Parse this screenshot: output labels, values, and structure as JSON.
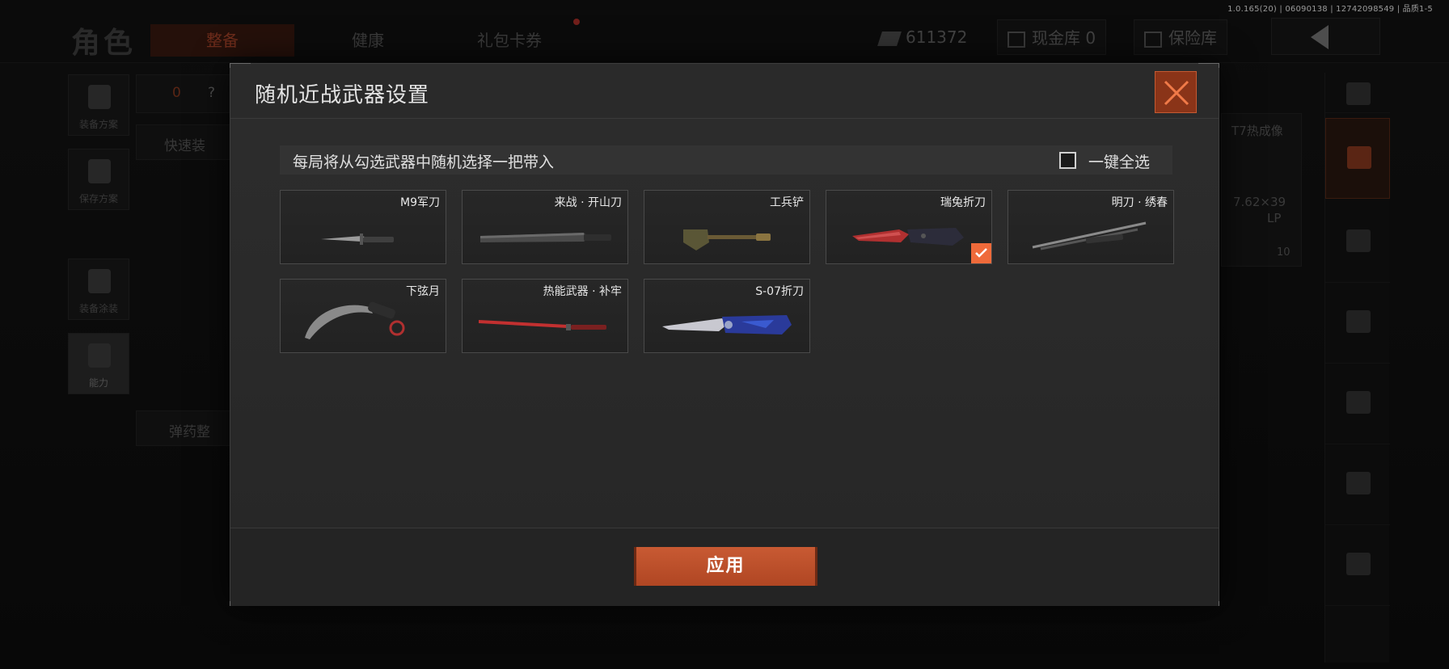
{
  "version_info": "1.0.165(20) | 06090138 | 12742098549 | 品质1-5",
  "background": {
    "page_title": "角色",
    "tabs": [
      {
        "label": "整备",
        "active": true
      },
      {
        "label": "健康",
        "active": false
      },
      {
        "label": "礼包卡券",
        "active": false
      }
    ],
    "currency_amount": "611372",
    "cash_vault": "现金库 0",
    "insurance_vault": "保险库",
    "side_menu": [
      "装备方案",
      "保存方案",
      "装备涂装",
      "能力"
    ],
    "left_panel": {
      "count": "0",
      "help": "?",
      "quick_equip": "快速装",
      "ammo": "弹药整"
    },
    "right_panel": {
      "item_name": "T7热成像",
      "ammo_name": "7.62×39",
      "ammo_type": "LP",
      "ammo_count": "10"
    }
  },
  "modal": {
    "title": "随机近战武器设置",
    "close_icon": "close-x-icon",
    "info_text": "每局将从勾选武器中随机选择一把带入",
    "select_all_label": "一键全选",
    "select_all_checked": false,
    "weapons": [
      {
        "name": "M9军刀",
        "icon": "combat-knife-icon",
        "checked": false
      },
      {
        "name": "来战 · 开山刀",
        "icon": "machete-icon",
        "checked": false
      },
      {
        "name": "工兵铲",
        "icon": "shovel-icon",
        "checked": false
      },
      {
        "name": "瑞兔折刀",
        "icon": "folding-knife-icon",
        "checked": true
      },
      {
        "name": "明刀 · 绣春",
        "icon": "dual-blades-icon",
        "checked": false
      },
      {
        "name": "下弦月",
        "icon": "karambit-icon",
        "checked": false
      },
      {
        "name": "热能武器 · 补牢",
        "icon": "thermal-blade-icon",
        "checked": false
      },
      {
        "name": "S-07折刀",
        "icon": "blue-folding-knife-icon",
        "checked": false
      }
    ],
    "apply_label": "应用"
  },
  "colors": {
    "accent": "#c85a33",
    "check": "#ef6a3a",
    "close_bg": "#8a3418"
  }
}
